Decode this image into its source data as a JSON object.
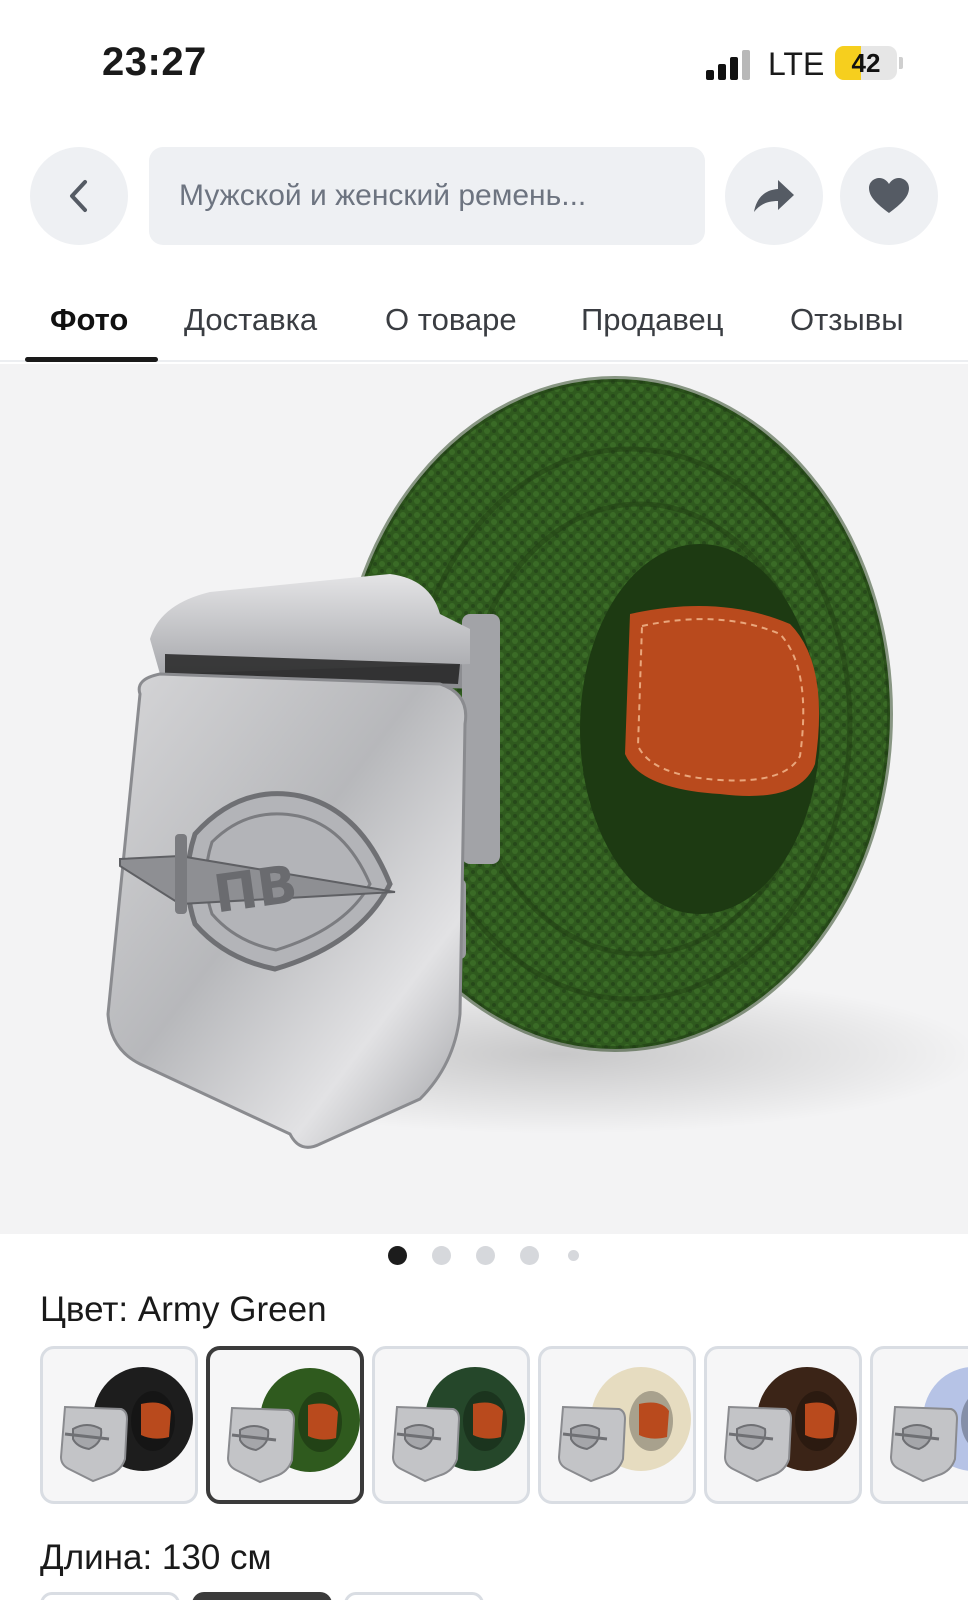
{
  "status_bar": {
    "time": "23:27",
    "network": "LTE",
    "battery": "42",
    "battery_level": 0.42
  },
  "header": {
    "back_icon": "chevron-left-icon",
    "title": "Мужской и женский ремень...",
    "share_icon": "share-arrow-icon",
    "favorite_icon": "heart-icon"
  },
  "tabs": [
    {
      "label": "Фото",
      "active": true
    },
    {
      "label": "Доставка",
      "active": false
    },
    {
      "label": "О товаре",
      "active": false
    },
    {
      "label": "Продавец",
      "active": false
    },
    {
      "label": "Отзывы",
      "active": false
    }
  ],
  "gallery": {
    "current": 1,
    "total": 5,
    "image": "green-canvas-belt-with-metal-buckle"
  },
  "options": {
    "color_label": "Цвет: Army Green",
    "colors": [
      {
        "name": "Black",
        "hex": "#1d1d1d"
      },
      {
        "name": "Army Green",
        "hex": "#2f5a1e",
        "selected": true
      },
      {
        "name": "Camo Green",
        "hex": "#25472a"
      },
      {
        "name": "Khaki",
        "hex": "#e6dcc0"
      },
      {
        "name": "Brown",
        "hex": "#3b2417"
      },
      {
        "name": "Light Blue",
        "hex": "#b6c3e6"
      }
    ],
    "length_label": "Длина: 130 см"
  },
  "colors": {
    "accent_dark": "#1a1a1a",
    "button_bg": "#eef0f3",
    "belt_green": "#2f5a1e",
    "leather": "#b94a1d"
  }
}
